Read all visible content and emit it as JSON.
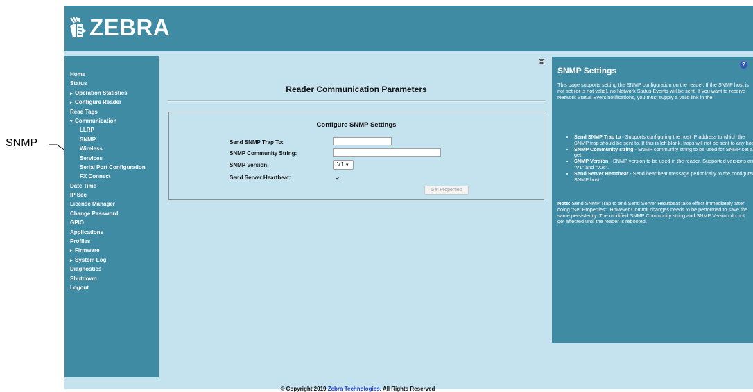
{
  "callout": {
    "label": "SNMP"
  },
  "brand": {
    "name": "ZEBRA"
  },
  "nav": {
    "items": [
      {
        "label": "Home",
        "level": 0
      },
      {
        "label": "Status",
        "level": 0
      },
      {
        "label": "Operation Statistics",
        "level": 0,
        "arrow": "▸"
      },
      {
        "label": "Configure Reader",
        "level": 0,
        "arrow": "▸"
      },
      {
        "label": "Read Tags",
        "level": 0
      },
      {
        "label": "Communication",
        "level": 0,
        "arrow": "▾"
      },
      {
        "label": "LLRP",
        "level": 1
      },
      {
        "label": "SNMP",
        "level": 1
      },
      {
        "label": "Wireless",
        "level": 1
      },
      {
        "label": "Services",
        "level": 1
      },
      {
        "label": "Serial Port Configuration",
        "level": 1
      },
      {
        "label": "FX Connect",
        "level": 1
      },
      {
        "label": "Date Time",
        "level": 0
      },
      {
        "label": "IP Sec",
        "level": 0
      },
      {
        "label": "License Manager",
        "level": 0
      },
      {
        "label": "Change Password",
        "level": 0
      },
      {
        "label": "GPIO",
        "level": 0
      },
      {
        "label": "Applications",
        "level": 0
      },
      {
        "label": "Profiles",
        "level": 0
      },
      {
        "label": "Firmware",
        "level": 0,
        "arrow": "▸"
      },
      {
        "label": "System Log",
        "level": 0,
        "arrow": "▸"
      },
      {
        "label": "Diagnostics",
        "level": 0
      },
      {
        "label": "Shutdown",
        "level": 0
      },
      {
        "label": "Logout",
        "level": 0
      }
    ]
  },
  "main": {
    "title": "Reader Communication Parameters",
    "panel": {
      "title": "Configure SNMP Settings",
      "trap_label": "Send SNMP Trap To:",
      "trap_value": "",
      "community_label": "SNMP Community String:",
      "community_value": "",
      "version_label": "SNMP Version:",
      "version_value": "V1",
      "heartbeat_label": "Send Server Heartbeat:",
      "heartbeat_checked": true,
      "set_button": "Set Properties"
    }
  },
  "help": {
    "title": "SNMP Settings",
    "icon": "?",
    "intro": "This page supports setting the SNMP configuration on the reader. If the SNMP host is not set (or is not valid), no Network Status Events will be sent. If you want to receive Network Status Event notifications, you must supply a valid link in the",
    "bullets": [
      {
        "term": "Send SNMP Trap to -",
        "text": " Supports configuring the host IP address to which the SNMP trap should be sent to. If this is left blank, traps will not be sent to any host."
      },
      {
        "term": "SNMP Community string -",
        "text": " SNMP community string to be used for SNMP set and get."
      },
      {
        "term": "SNMP Version",
        "text": " - SNMP version to be used in the reader. Supported versions are \"V1\" and \"V2c\"."
      },
      {
        "term": "Send Server Heartbeat",
        "text": " - Send heartbeat message periodically to the configured SNMP host."
      }
    ],
    "note_term": "Note:",
    "note_text": " Send SNMP Trap to and Send Server Heartbeat take effect immediately after doing \"Set Properties\". However Commit changes needs to be performed to save the same persistently. The modified SNMP Community string and SNMP Version do not get affected until the reader is rebooted."
  },
  "footer": {
    "prefix": "© Copyright 2019 ",
    "link": "Zebra Technologies",
    "suffix": ". All Rights Reserved"
  }
}
